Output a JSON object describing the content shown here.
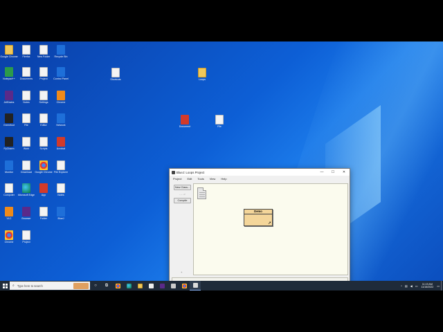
{
  "desktop": {
    "icons": [
      {
        "label": "Google Chrome",
        "glyph": "g-folder"
      },
      {
        "label": "Firefox",
        "glyph": "g-doc"
      },
      {
        "label": "New Folder",
        "glyph": "g-doc"
      },
      {
        "label": "Recycle Bin",
        "glyph": "g-blue"
      },
      {
        "label": "Notepad++",
        "glyph": "g-green"
      },
      {
        "label": "Documents",
        "glyph": "g-doc"
      },
      {
        "label": "Project",
        "glyph": "g-doc"
      },
      {
        "label": "Control Panel",
        "glyph": "g-blue"
      },
      {
        "label": "JetBrains",
        "glyph": "g-purple"
      },
      {
        "label": "Notes",
        "glyph": "g-doc"
      },
      {
        "label": "Settings",
        "glyph": "g-doc"
      },
      {
        "label": "Chrome",
        "glyph": "g-orange"
      },
      {
        "label": "Greenfoot",
        "glyph": "g-dark"
      },
      {
        "label": "File",
        "glyph": "g-doc"
      },
      {
        "label": "Editor",
        "glyph": "g-doc"
      },
      {
        "label": "Network",
        "glyph": "g-blue"
      },
      {
        "label": "PyCharm",
        "glyph": "g-dark"
      },
      {
        "label": "Work",
        "glyph": "g-doc"
      },
      {
        "label": "Scripts",
        "glyph": "g-doc"
      },
      {
        "label": "Acrobat",
        "glyph": "g-red"
      },
      {
        "label": "Monitor",
        "glyph": "g-blue"
      },
      {
        "label": "Download",
        "glyph": "g-doc"
      },
      {
        "label": "Google Chrome",
        "glyph": "g-chrome"
      },
      {
        "label": "File Explorer",
        "glyph": "g-doc"
      },
      {
        "label": "Computer",
        "glyph": "g-doc"
      },
      {
        "label": "Microsoft Edge",
        "glyph": "g-edge"
      },
      {
        "label": "App",
        "glyph": "g-red"
      },
      {
        "label": "Notes",
        "glyph": "g-doc"
      },
      {
        "label": "VLC",
        "glyph": "g-orange"
      },
      {
        "label": "Browser",
        "glyph": "g-purple"
      },
      {
        "label": "Folder",
        "glyph": "g-doc"
      },
      {
        "label": "BlueJ",
        "glyph": "g-blue"
      },
      {
        "label": "Chrome",
        "glyph": "g-chrome"
      },
      {
        "label": "Project",
        "glyph": "g-doc"
      },
      {
        "label": "Shortcuts",
        "glyph": "g-doc"
      },
      {
        "label": "Loops",
        "glyph": "g-folder"
      },
      {
        "label": "Document",
        "glyph": "g-red"
      },
      {
        "label": "File",
        "glyph": "g-doc"
      }
    ]
  },
  "window": {
    "title": "BlueJ: Loops Project",
    "controls": {
      "minimize": "—",
      "maximize": "☐",
      "close": "✕"
    },
    "menu": [
      "Project",
      "Edit",
      "Tools",
      "View",
      "Help"
    ],
    "sidebar": {
      "new_class": "New Class...",
      "arrow": "- - ->",
      "compile": "Compile",
      "spinner": "+"
    },
    "class_name": "Demo"
  },
  "taskbar": {
    "search_placeholder": "Type here to search",
    "icons": [
      "task-view-icon",
      "chrome-icon",
      "edge-icon",
      "file-explorer-icon",
      "store-icon",
      "settings-icon",
      "mail-icon",
      "chrome-icon",
      "bluej-icon"
    ],
    "time": "11:19 AM",
    "date": "11/16/2022"
  }
}
